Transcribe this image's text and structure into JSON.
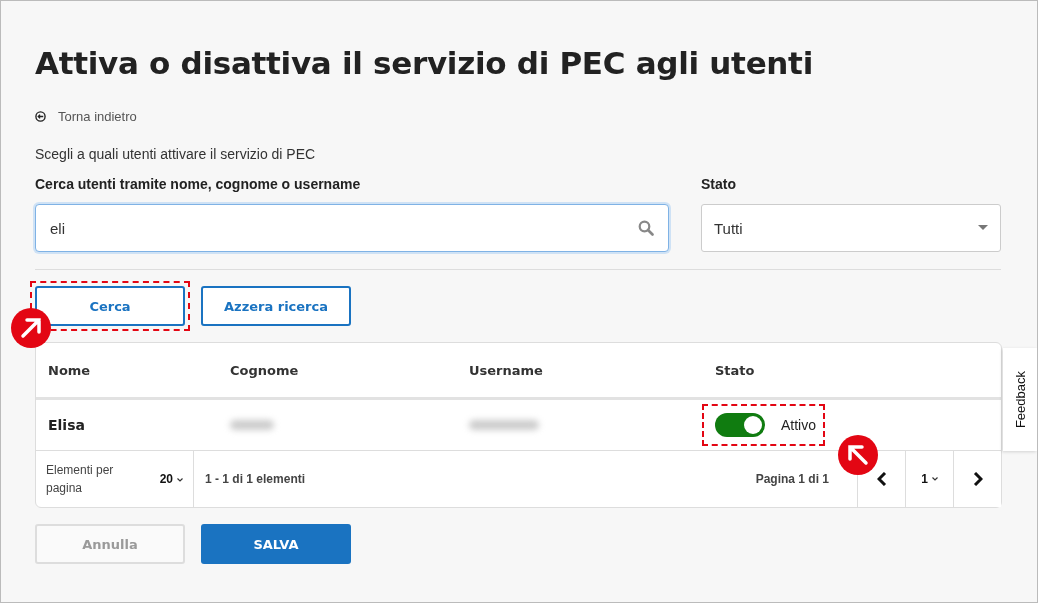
{
  "title": "Attiva o disattiva il servizio di PEC agli utenti",
  "back_link": "Torna indietro",
  "intro": "Scegli a quali utenti attivare il servizio di PEC",
  "search": {
    "label": "Cerca utenti tramite nome, cognome o username",
    "value": "eli"
  },
  "status_filter": {
    "label": "Stato",
    "value": "Tutti"
  },
  "buttons": [
    {
      "label": "Cerca",
      "highlighted": true
    },
    {
      "label": "Azzera ricerca",
      "highlighted": false
    }
  ],
  "table": {
    "columns": [
      "Nome",
      "Cognome",
      "Username",
      "Stato"
    ],
    "rows": [
      {
        "name": "Elisa",
        "active": true,
        "status_label": "Attivo",
        "highlighted": true
      }
    ],
    "footer": {
      "per_page_label": "Elementi per pagina",
      "per_page": "20",
      "range": "1 - 1 di 1 elementi",
      "page_info": "Pagina 1 di 1",
      "page": "1"
    }
  },
  "actions": [
    {
      "label": "Annulla",
      "disabled": true
    },
    {
      "label": "SALVA",
      "disabled": false
    }
  ],
  "feedback_tab": "Feedback"
}
